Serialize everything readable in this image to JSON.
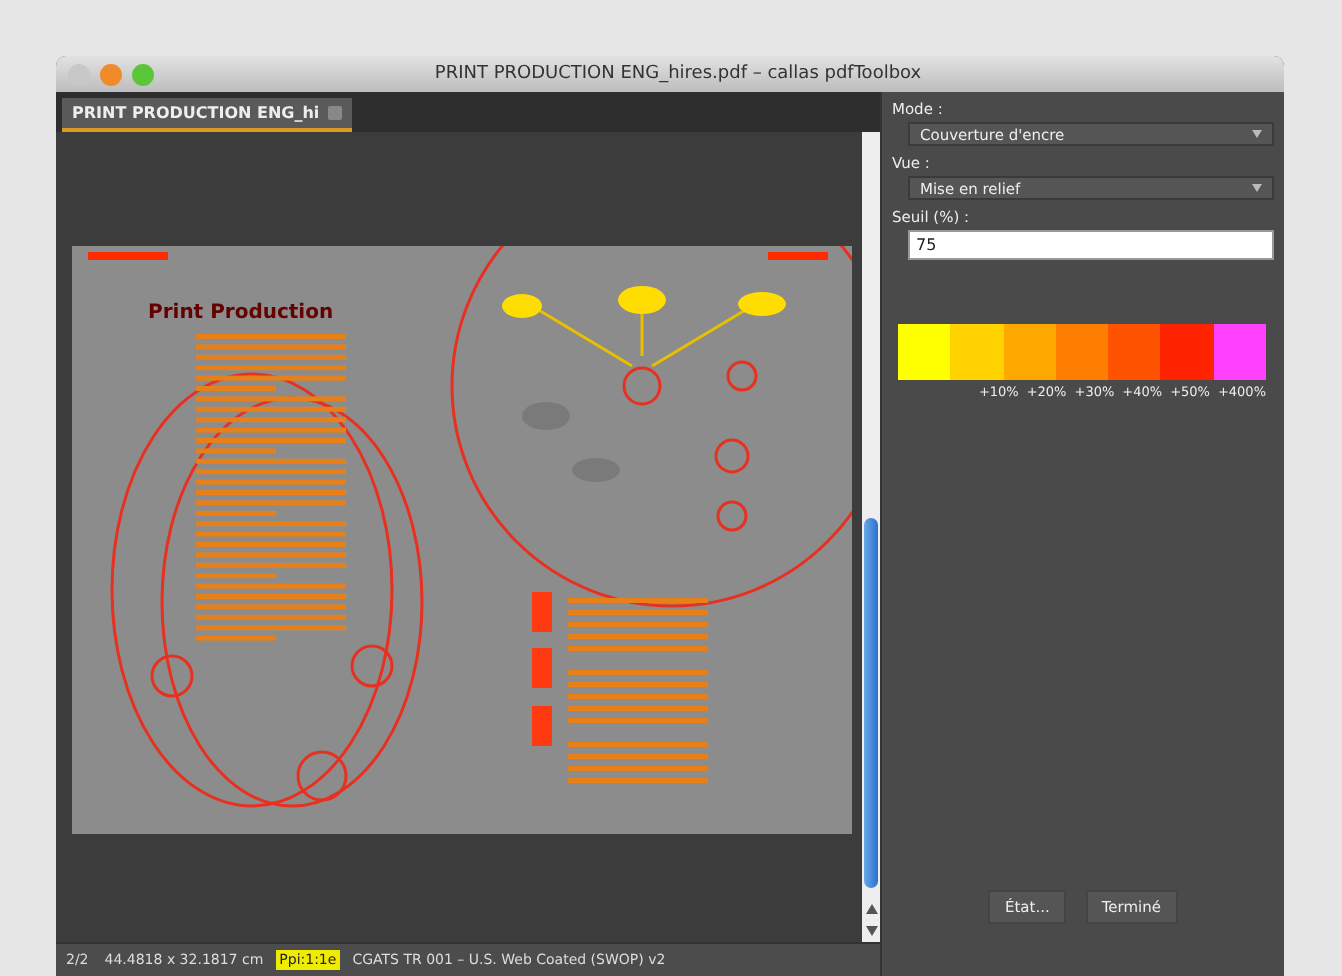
{
  "window": {
    "title": "PRINT PRODUCTION ENG_hires.pdf – callas pdfToolbox"
  },
  "tabs": [
    {
      "label": "PRINT PRODUCTION ENG_hi",
      "selected": true
    }
  ],
  "document": {
    "heading": "Print Production"
  },
  "panel": {
    "mode_label": "Mode :",
    "mode_value": "Couverture d'encre",
    "view_label": "Vue :",
    "view_value": "Mise en relief",
    "threshold_label": "Seuil (%) :",
    "threshold_value": "75",
    "legend": [
      {
        "color": "#ffff00"
      },
      {
        "color": "#ffd200"
      },
      {
        "color": "#ffa800"
      },
      {
        "color": "#ff7d00"
      },
      {
        "color": "#ff5200"
      },
      {
        "color": "#ff2400"
      },
      {
        "color": "#ff40ff"
      }
    ],
    "legend_labels": [
      "+10%",
      "+20%",
      "+30%",
      "+40%",
      "+50%",
      "+400%"
    ],
    "buttons": [
      "État...",
      "Terminé"
    ]
  },
  "status_bar": {
    "page": "2/2",
    "size": "44.4818 x 32.1817 cm",
    "zoom": "Ppi:1:1e",
    "profile": "CGATS TR 001 – U.S. Web Coated (SWOP) v2"
  }
}
